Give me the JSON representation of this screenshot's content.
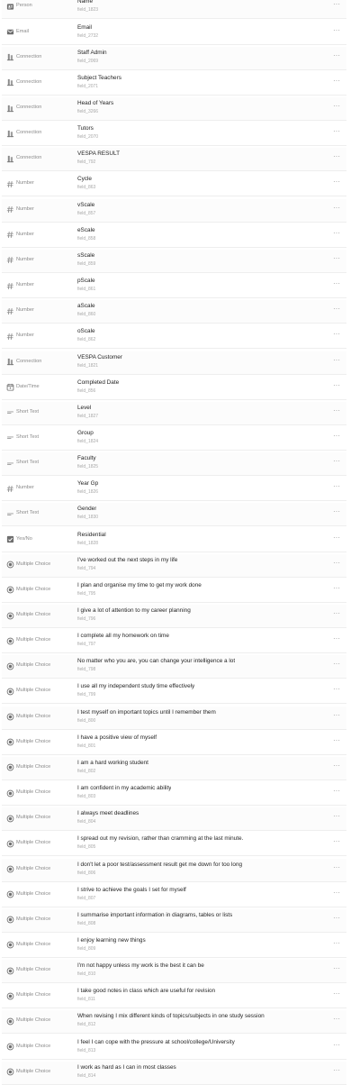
{
  "fields": [
    {
      "type": "Person",
      "icon": "person-icon",
      "name": "Name",
      "key": "field_1823"
    },
    {
      "type": "Email",
      "icon": "email-icon",
      "name": "Email",
      "key": "field_2732"
    },
    {
      "type": "Connection",
      "icon": "connection-icon",
      "name": "Staff Admin",
      "key": "field_2069"
    },
    {
      "type": "Connection",
      "icon": "connection-icon",
      "name": "Subject Teachers",
      "key": "field_2071"
    },
    {
      "type": "Connection",
      "icon": "connection-icon",
      "name": "Head of Years",
      "key": "field_3266"
    },
    {
      "type": "Connection",
      "icon": "connection-icon",
      "name": "Tutors",
      "key": "field_2070"
    },
    {
      "type": "Connection",
      "icon": "connection-icon",
      "name": "VESPA RESULT",
      "key": "field_792"
    },
    {
      "type": "Number",
      "icon": "number-icon",
      "name": "Cycle",
      "key": "field_863"
    },
    {
      "type": "Number",
      "icon": "number-icon",
      "name": "vScale",
      "key": "field_857"
    },
    {
      "type": "Number",
      "icon": "number-icon",
      "name": "eScale",
      "key": "field_858"
    },
    {
      "type": "Number",
      "icon": "number-icon",
      "name": "sScale",
      "key": "field_859"
    },
    {
      "type": "Number",
      "icon": "number-icon",
      "name": "pScale",
      "key": "field_861"
    },
    {
      "type": "Number",
      "icon": "number-icon",
      "name": "aScale",
      "key": "field_860"
    },
    {
      "type": "Number",
      "icon": "number-icon",
      "name": "oScale",
      "key": "field_862"
    },
    {
      "type": "Connection",
      "icon": "connection-icon",
      "name": "VESPA Customer",
      "key": "field_1821"
    },
    {
      "type": "Date/Time",
      "icon": "calendar-icon",
      "name": "Completed Date",
      "key": "field_856"
    },
    {
      "type": "Short Text",
      "icon": "short-text-icon",
      "name": "Level",
      "key": "field_1827"
    },
    {
      "type": "Short Text",
      "icon": "short-text-icon",
      "name": "Group",
      "key": "field_1824"
    },
    {
      "type": "Short Text",
      "icon": "short-text-icon",
      "name": "Faculty",
      "key": "field_1825"
    },
    {
      "type": "Number",
      "icon": "number-icon",
      "name": "Year Gp",
      "key": "field_1826"
    },
    {
      "type": "Short Text",
      "icon": "short-text-icon",
      "name": "Gender",
      "key": "field_1830"
    },
    {
      "type": "Yes/No",
      "icon": "checkbox-icon",
      "name": "Residential",
      "key": "field_1828"
    },
    {
      "type": "Multiple Choice",
      "icon": "multiple-choice-icon",
      "name": "I've worked out the next steps in my life",
      "key": "field_794"
    },
    {
      "type": "Multiple Choice",
      "icon": "multiple-choice-icon",
      "name": "I plan and organise my time to get my work done",
      "key": "field_795"
    },
    {
      "type": "Multiple Choice",
      "icon": "multiple-choice-icon",
      "name": "I give a lot of attention to my career planning",
      "key": "field_796"
    },
    {
      "type": "Multiple Choice",
      "icon": "multiple-choice-icon",
      "name": "I complete all my homework on time",
      "key": "field_797"
    },
    {
      "type": "Multiple Choice",
      "icon": "multiple-choice-icon",
      "name": "No matter who you are, you can change your intelligence a lot",
      "key": "field_798"
    },
    {
      "type": "Multiple Choice",
      "icon": "multiple-choice-icon",
      "name": "I use all my independent study time effectively",
      "key": "field_799"
    },
    {
      "type": "Multiple Choice",
      "icon": "multiple-choice-icon",
      "name": "I test myself on important topics until I remember them",
      "key": "field_800"
    },
    {
      "type": "Multiple Choice",
      "icon": "multiple-choice-icon",
      "name": "I have a positive view of myself",
      "key": "field_801"
    },
    {
      "type": "Multiple Choice",
      "icon": "multiple-choice-icon",
      "name": "I am a hard working student",
      "key": "field_802"
    },
    {
      "type": "Multiple Choice",
      "icon": "multiple-choice-icon",
      "name": "I am confident in my academic ability",
      "key": "field_803"
    },
    {
      "type": "Multiple Choice",
      "icon": "multiple-choice-icon",
      "name": "I always meet deadlines",
      "key": "field_804"
    },
    {
      "type": "Multiple Choice",
      "icon": "multiple-choice-icon",
      "name": "I spread out my revision, rather than cramming at the last minute.",
      "key": "field_805"
    },
    {
      "type": "Multiple Choice",
      "icon": "multiple-choice-icon",
      "name": "I don't let a poor test/assessment result get me down for too long",
      "key": "field_806"
    },
    {
      "type": "Multiple Choice",
      "icon": "multiple-choice-icon",
      "name": "I strive to achieve the goals I set for myself",
      "key": "field_807"
    },
    {
      "type": "Multiple Choice",
      "icon": "multiple-choice-icon",
      "name": "I summarise important information in diagrams, tables or lists",
      "key": "field_808"
    },
    {
      "type": "Multiple Choice",
      "icon": "multiple-choice-icon",
      "name": "I enjoy learning new things",
      "key": "field_809"
    },
    {
      "type": "Multiple Choice",
      "icon": "multiple-choice-icon",
      "name": "I'm not happy unless my work is the best it can be",
      "key": "field_810"
    },
    {
      "type": "Multiple Choice",
      "icon": "multiple-choice-icon",
      "name": "I take good notes in class which are useful for revision",
      "key": "field_811"
    },
    {
      "type": "Multiple Choice",
      "icon": "multiple-choice-icon",
      "name": "When revising I mix different kinds of topics/subjects in one study session",
      "key": "field_812"
    },
    {
      "type": "Multiple Choice",
      "icon": "multiple-choice-icon",
      "name": "I feel I can cope with the pressure at school/college/University",
      "key": "field_813"
    },
    {
      "type": "Multiple Choice",
      "icon": "multiple-choice-icon",
      "name": "I work as hard as I can in most classes",
      "key": "field_814"
    }
  ],
  "more_label": "···"
}
